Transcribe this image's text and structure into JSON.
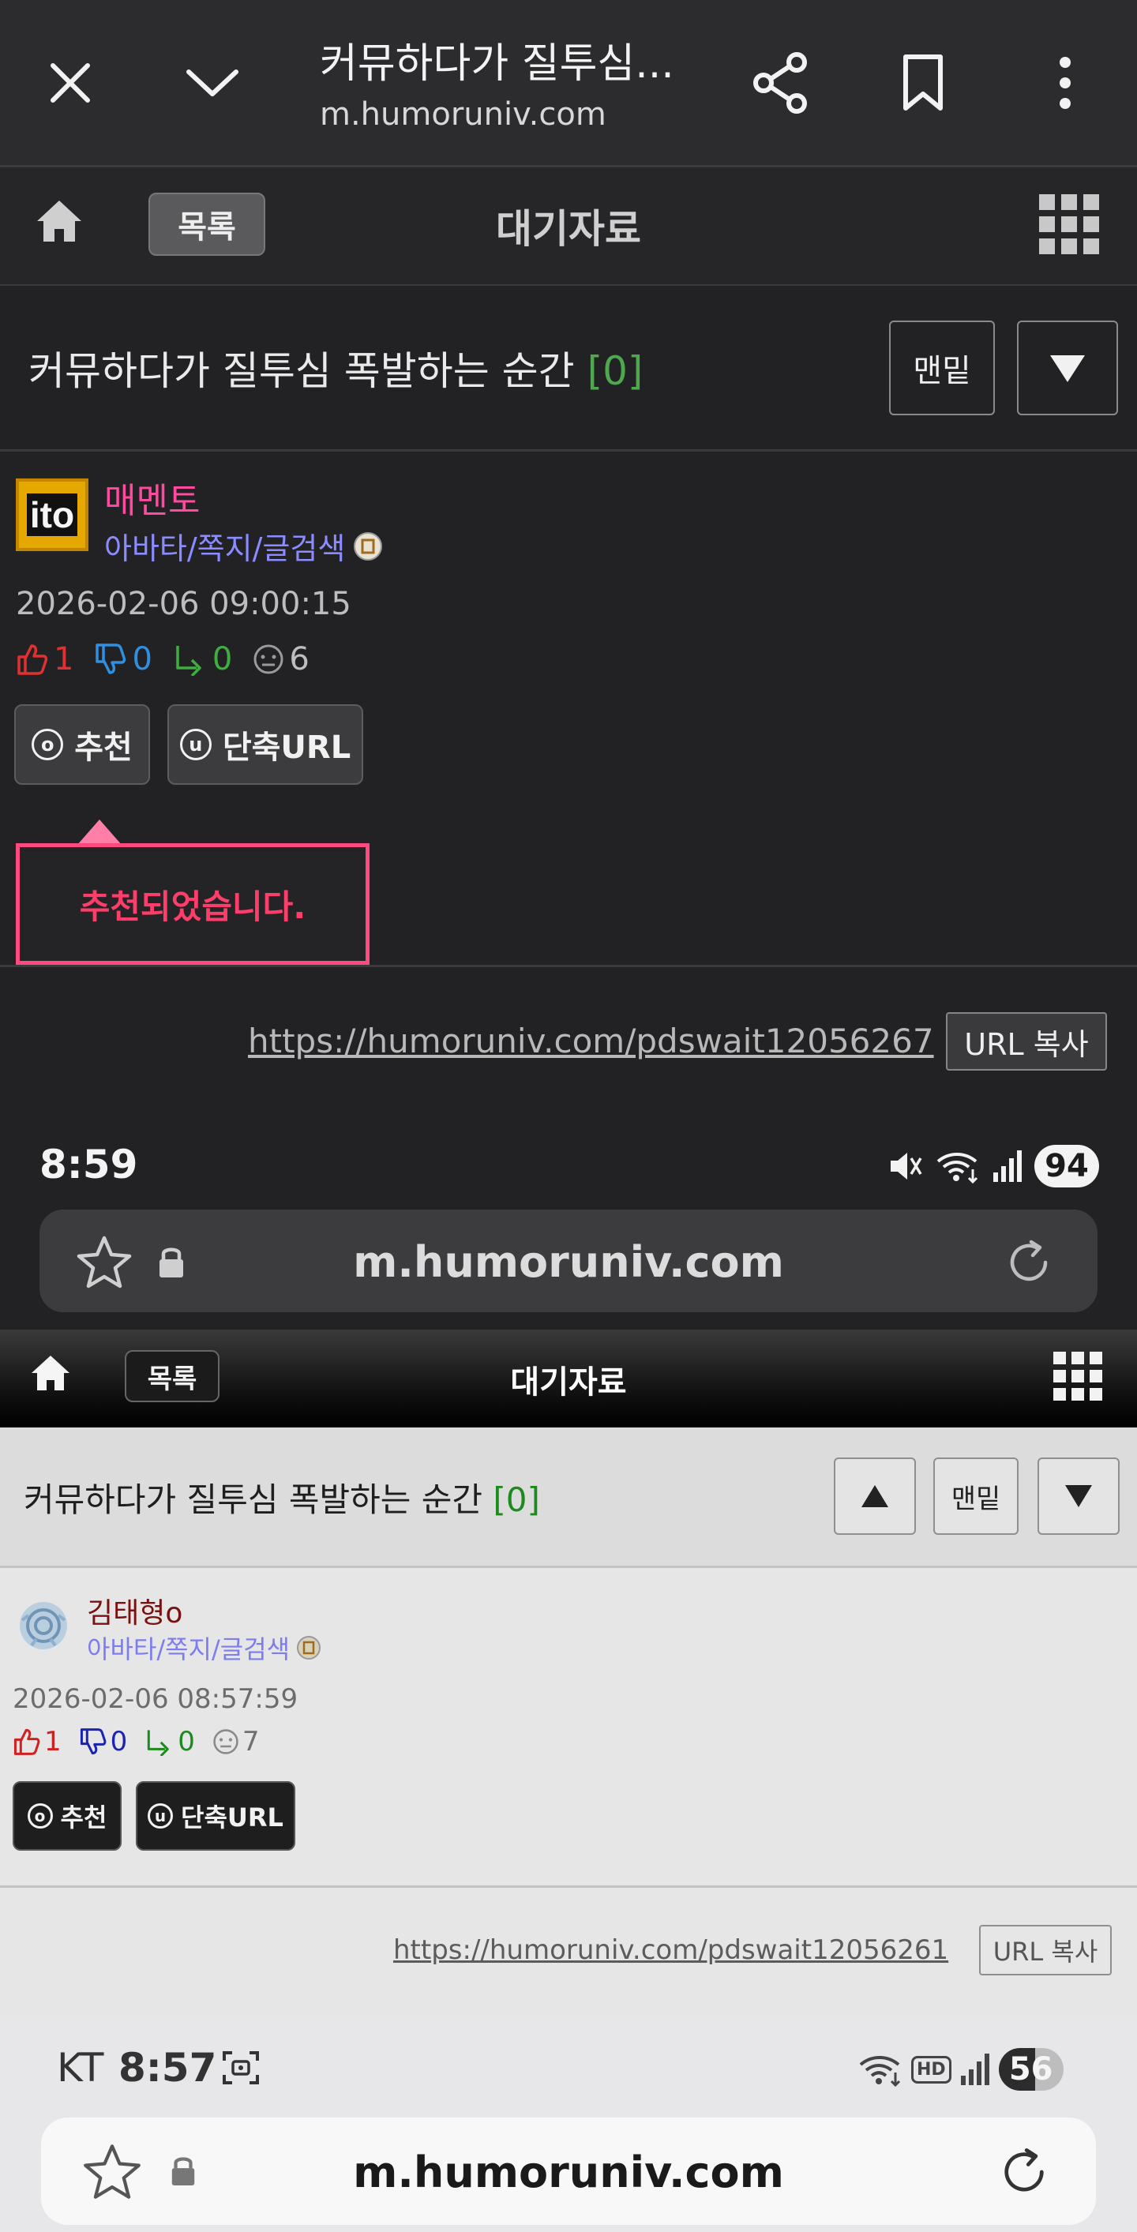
{
  "chrome": {
    "title": "커뮤하다가 질투심...",
    "url": "m.humoruniv.com"
  },
  "dark_view": {
    "nav": {
      "list_label": "목록",
      "title": "대기자료"
    },
    "post": {
      "title": "커뮤하다가 질투심 폭발하는 순간",
      "comment_count": "[0]",
      "bottom_label": "맨밑"
    },
    "author": {
      "avatar_text": "ito",
      "name": "매멘토",
      "links": "아바타/쪽지/글검색",
      "date": "2026-02-06 09:00:15",
      "stats": {
        "likes": "1",
        "dislikes": "0",
        "shares": "0",
        "views": "6"
      }
    },
    "actions": {
      "recommend": "추천",
      "recommend_icon": "o",
      "short_url": "단축URL",
      "short_url_icon": "u"
    },
    "tooltip": "추천되었습니다.",
    "post_url": "https://humoruniv.com/pdswait12056267",
    "copy_url": "URL 복사",
    "status": {
      "time": "8:59",
      "battery": "94"
    },
    "address": "m.humoruniv.com"
  },
  "light_view": {
    "nav": {
      "list_label": "목록",
      "title": "대기자료"
    },
    "post": {
      "title": "커뮤하다가 질투심 폭발하는 순간",
      "comment_count": "[0]",
      "bottom_label": "맨밑"
    },
    "author": {
      "name": "김태형o",
      "links": "아바타/쪽지/글검색",
      "date": "2026-02-06 08:57:59",
      "stats": {
        "likes": "1",
        "dislikes": "0",
        "shares": "0",
        "views": "7"
      }
    },
    "actions": {
      "recommend": "추천",
      "recommend_icon": "o",
      "short_url": "단축URL",
      "short_url_icon": "u"
    },
    "post_url": "https://humoruniv.com/pdswait12056261",
    "copy_url": "URL 복사",
    "status": {
      "carrier": "KT",
      "time": "8:57",
      "battery": "56",
      "hd": "HD"
    },
    "address": "m.humoruniv.com"
  },
  "colors": {
    "accent_pink": "#ff4aa0",
    "tooltip_border": "#ff4a80",
    "like_red": "#e03030",
    "dislike_blue": "#2f8fe0",
    "share_green": "#4ea94e"
  }
}
